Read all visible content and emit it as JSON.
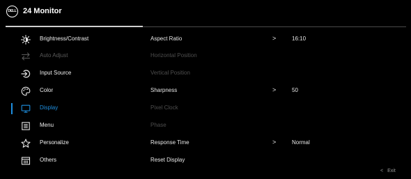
{
  "header": {
    "logo_text": "DELL",
    "title": "24 Monitor"
  },
  "menu": {
    "items": [
      {
        "label": "Brightness/Contrast",
        "icon": "brightness-icon",
        "state": "normal"
      },
      {
        "label": "Auto Adjust",
        "icon": "auto-adjust-icon",
        "state": "disabled"
      },
      {
        "label": "Input Source",
        "icon": "input-source-icon",
        "state": "normal"
      },
      {
        "label": "Color",
        "icon": "color-icon",
        "state": "normal"
      },
      {
        "label": "Display",
        "icon": "display-icon",
        "state": "selected"
      },
      {
        "label": "Menu",
        "icon": "menu-icon",
        "state": "normal"
      },
      {
        "label": "Personalize",
        "icon": "star-icon",
        "state": "normal"
      },
      {
        "label": "Others",
        "icon": "others-icon",
        "state": "normal"
      }
    ]
  },
  "panel": {
    "rows": [
      {
        "label": "Aspect Ratio",
        "chevron": ">",
        "value": "16:10",
        "state": "normal"
      },
      {
        "label": "Horizontal Position",
        "chevron": "",
        "value": "",
        "state": "disabled"
      },
      {
        "label": "Vertical Position",
        "chevron": "",
        "value": "",
        "state": "disabled"
      },
      {
        "label": "Sharpness",
        "chevron": ">",
        "value": "50",
        "state": "normal"
      },
      {
        "label": "Pixel Clock",
        "chevron": "",
        "value": "",
        "state": "disabled"
      },
      {
        "label": "Phase",
        "chevron": "",
        "value": "",
        "state": "disabled"
      },
      {
        "label": "Response Time",
        "chevron": ">",
        "value": "Normal",
        "state": "normal"
      },
      {
        "label": "Reset Display",
        "chevron": "",
        "value": "",
        "state": "normal"
      }
    ]
  },
  "footer": {
    "exit_chevron": "<",
    "exit_label": "Exit"
  },
  "colors": {
    "background": "#000000",
    "accent": "#1e8fe0",
    "text": "#e6e6e6",
    "disabled_text": "#4e4e4e"
  }
}
